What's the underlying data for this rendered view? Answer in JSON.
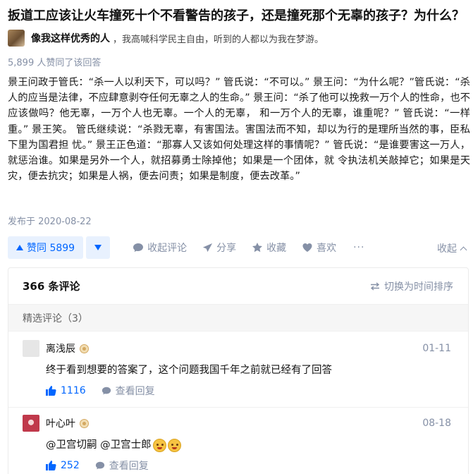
{
  "question": {
    "title": "扳道工应该让火车撞死十个不看警告的孩子，还是撞死那个无辜的孩子？为什么？"
  },
  "author": {
    "name": "像我这样优秀的人",
    "bio": "，我高喊科学民主自由，听到的人都以为我在梦游。"
  },
  "answer": {
    "agree_text": "5,899 人赞同了该回答",
    "body": "景王问政于管氏：“杀一人以利天下，可以吗？” 管氏说：“不可以。” 景王问：“为什么呢？”管氏说：“杀人的应当是法律，不应肆意剥夺任何无辜之人的生命。” 景王问：“杀了他可以挽救一万个人的性命，也不应该做吗？他无辜，一万个人也无辜。一个人的无辜， 和一万个人的无辜，谁重呢？” 管氏说：“一样重。” 景王笑。 管氏继续说：“杀戮无辜，有害国法。害国法而不知，却以为行的是理所当然的事，臣私下里为国君担 忧。” 景王正色道：“那寡人又该如何处理这样的事情呢？” 管氏说：“是谁要害这一万人，就惩治谁。如果是另外一个人，就招募勇士除掉他；如果是一个团体，就 令执法机关敲掉它；如果是天灾，便去抗灾；如果是人祸，便去问责；如果是制度，便去改革。”",
    "publish_date": "发布于 2020-08-22"
  },
  "actions": {
    "upvote_label": "赞同 5899",
    "comment_label": "收起评论",
    "share_label": "分享",
    "favorite_label": "收藏",
    "like_label": "喜欢",
    "more_label": "···",
    "collapse_label": "收起"
  },
  "comments": {
    "count_label": "366 条评论",
    "sort_label": "切换为时间排序",
    "featured_label": "精选评论（3）",
    "items": [
      {
        "name": "离浅辰",
        "date": "01-11",
        "text": "终于看到想要的答案了，这个问题我国千年之前就已经有了回答",
        "likes": "1116",
        "reply_label": "查看回复",
        "avatar_color": "#e6e6e6"
      },
      {
        "name": "叶心叶",
        "date": "08-18",
        "text": "@卫宫切嗣 @卫宫士郎",
        "likes": "252",
        "reply_label": "查看回复",
        "avatar_color": "#c0394b"
      }
    ]
  },
  "colors": {
    "accent": "#0066ff",
    "muted": "#8590a6"
  }
}
